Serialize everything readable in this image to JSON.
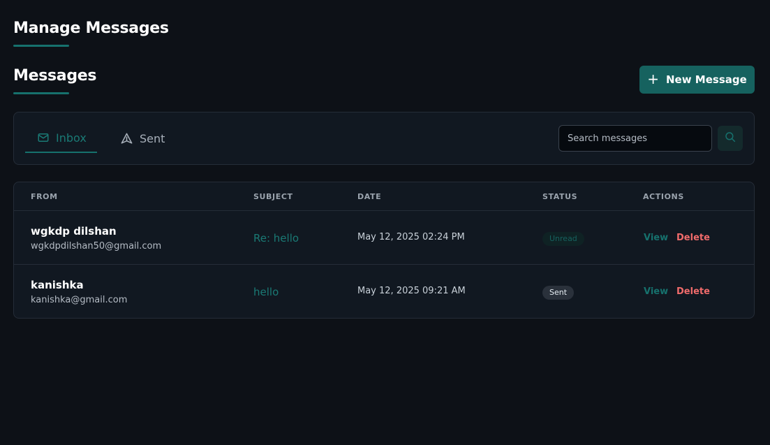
{
  "header": {
    "title": "Manage Messages",
    "section_title": "Messages",
    "new_message_label": "New Message"
  },
  "tabs": [
    {
      "label": "Inbox",
      "icon": "mail-icon",
      "active": true
    },
    {
      "label": "Sent",
      "icon": "send-icon",
      "active": false
    }
  ],
  "search": {
    "placeholder": "Search messages",
    "value": ""
  },
  "table": {
    "columns": [
      "FROM",
      "SUBJECT",
      "DATE",
      "STATUS",
      "ACTIONS"
    ],
    "rows": [
      {
        "from_name": "wgkdp dilshan",
        "from_email": "wgkdpdilshan50@gmail.com",
        "subject": "Re: hello",
        "date": "May 12, 2025 02:24 PM",
        "status": "Unread",
        "view_label": "View",
        "delete_label": "Delete"
      },
      {
        "from_name": "kanishka",
        "from_email": "kanishka@gmail.com",
        "subject": "hello",
        "date": "May 12, 2025 09:21 AM",
        "status": "Sent",
        "view_label": "View",
        "delete_label": "Delete"
      }
    ]
  },
  "colors": {
    "background": "#0d1117",
    "accent": "#16716d",
    "danger": "#f06b6b",
    "card": "#111821"
  }
}
